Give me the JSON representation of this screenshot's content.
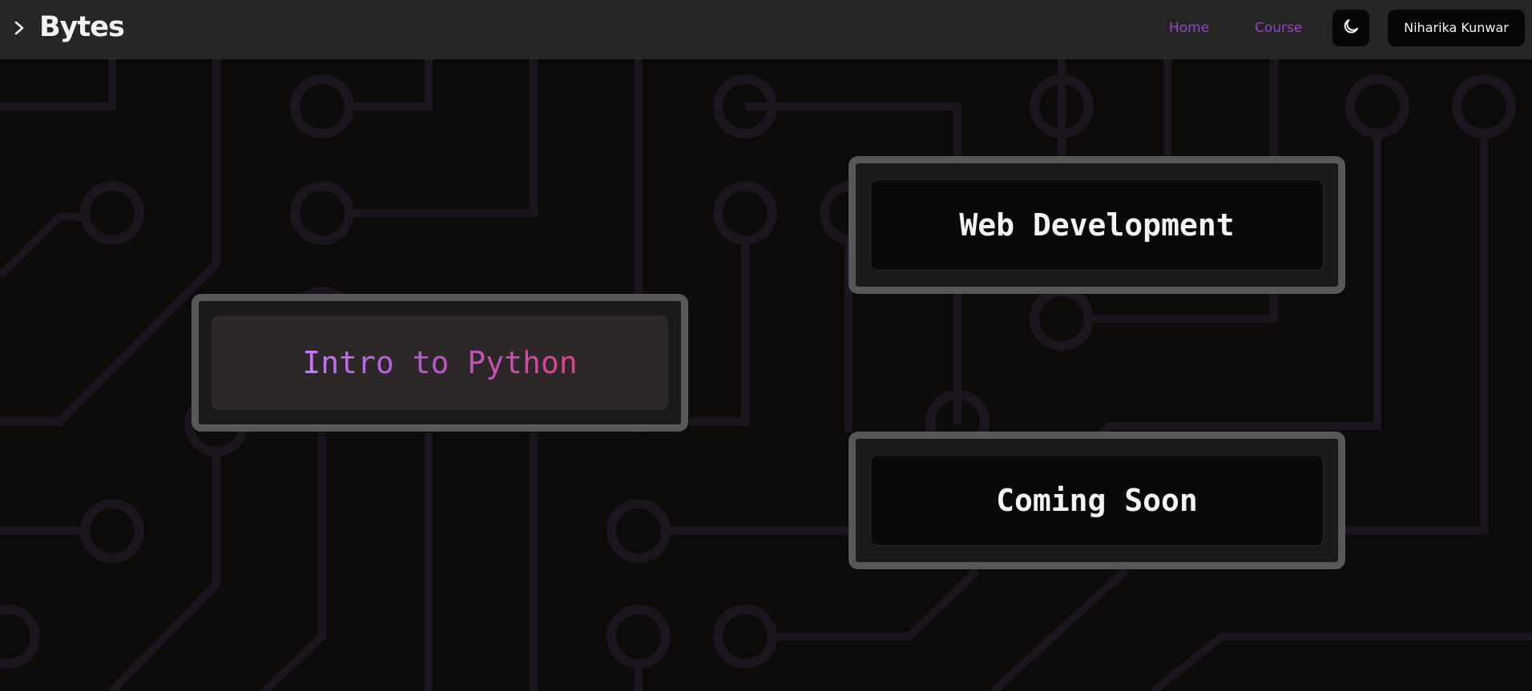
{
  "app": {
    "brand": "Bytes"
  },
  "nav": {
    "home_label": "Home",
    "course_label": "Course",
    "theme_icon": "moon-icon",
    "user_name": "Niharika Kunwar",
    "menu_icon": "chevron-right-icon"
  },
  "courses": [
    {
      "title": "Intro to Python",
      "active": true
    },
    {
      "title": "Web Development",
      "active": false
    },
    {
      "title": "Coming Soon",
      "active": false
    }
  ],
  "colors": {
    "background": "#0c0b0a",
    "header": "#262626",
    "nav_link": "#9a3fd1",
    "circuit": "#1c1520",
    "card_border": "#58575a",
    "title_gradient_start": "#c779ff",
    "title_gradient_end": "#e0418c"
  }
}
